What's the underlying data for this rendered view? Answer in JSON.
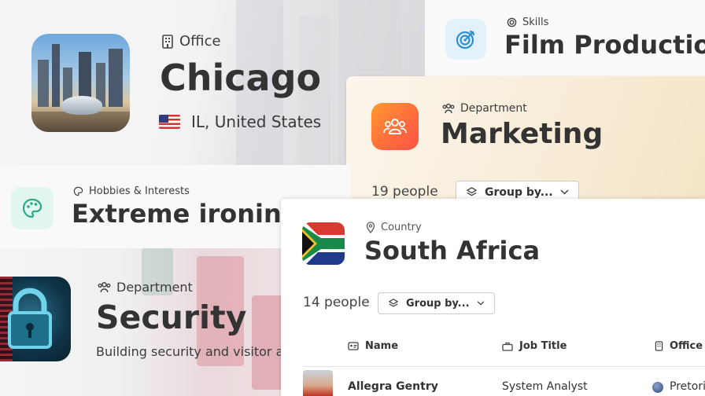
{
  "chicago": {
    "eyebrow": "Office",
    "title": "Chicago",
    "location": "IL, United States",
    "eyebrow_icon": "building-icon",
    "flag": "us-flag"
  },
  "film": {
    "eyebrow": "Skills",
    "title": "Film Production",
    "icon": "target-icon",
    "accent": "#2f8fd0"
  },
  "marketing": {
    "eyebrow": "Department",
    "title": "Marketing",
    "people_count": "19 people",
    "group_by": "Group by...",
    "icon": "people-group-icon",
    "accent": "#ff7a36"
  },
  "ironing": {
    "eyebrow": "Hobbies & Interests",
    "title": "Extreme ironing",
    "icon": "palette-icon",
    "accent": "#2fa88a"
  },
  "security": {
    "eyebrow": "Department",
    "title": "Security",
    "description": "Building security and visitor acce"
  },
  "south_africa": {
    "eyebrow": "Country",
    "title": "South Africa",
    "people_count": "14 people",
    "group_by": "Group by...",
    "columns": [
      "Name",
      "Job Title",
      "Office"
    ],
    "rows": [
      {
        "name": "Allegra Gentry",
        "job_title": "System Analyst",
        "office": "Pretoria"
      }
    ]
  }
}
